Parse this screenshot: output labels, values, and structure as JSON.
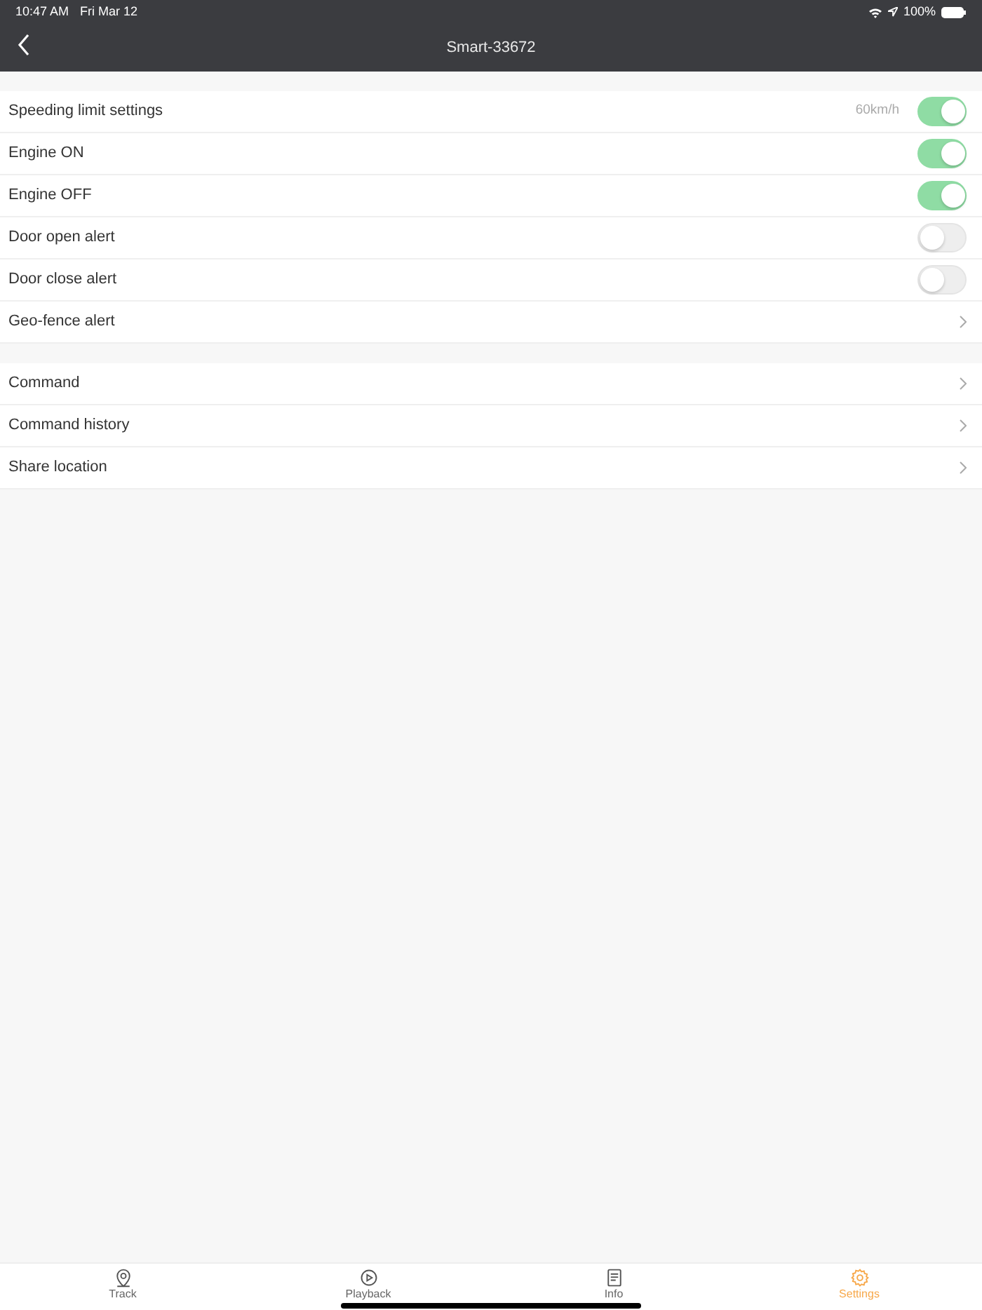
{
  "status_bar": {
    "time": "10:47 AM",
    "date": "Fri Mar 12",
    "battery": "100%"
  },
  "nav_bar": {
    "title": "Smart-33672"
  },
  "sections": [
    {
      "rows": [
        {
          "kind": "toggle",
          "label": "Speeding limit settings",
          "value": "60km/h",
          "on": true
        },
        {
          "kind": "toggle",
          "label": "Engine ON",
          "on": true
        },
        {
          "kind": "toggle",
          "label": "Engine OFF",
          "on": true
        },
        {
          "kind": "toggle",
          "label": "Door open alert",
          "on": false
        },
        {
          "kind": "toggle",
          "label": "Door close alert",
          "on": false
        },
        {
          "kind": "link",
          "label": "Geo-fence alert"
        }
      ]
    },
    {
      "rows": [
        {
          "kind": "link",
          "label": "Command"
        },
        {
          "kind": "link",
          "label": "Command history"
        },
        {
          "kind": "link",
          "label": "Share location"
        }
      ]
    }
  ],
  "tab_bar": [
    {
      "kind": "track",
      "label": "Track",
      "selected": false
    },
    {
      "kind": "playback",
      "label": "Playback",
      "selected": false
    },
    {
      "kind": "info",
      "label": "Info",
      "selected": false
    },
    {
      "kind": "settings",
      "label": "Settings",
      "selected": true
    }
  ]
}
